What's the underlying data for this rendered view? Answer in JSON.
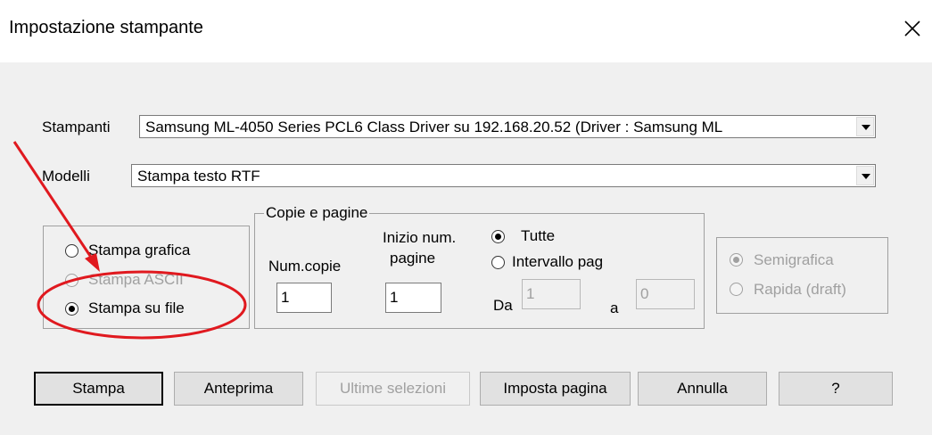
{
  "window": {
    "title": "Impostazione stampante"
  },
  "printers": {
    "label": "Stampanti",
    "selected": "Samsung ML-4050 Series PCL6 Class Driver su 192.168.20.52 (Driver : Samsung ML"
  },
  "models": {
    "label": "Modelli",
    "selected": "Stampa testo RTF"
  },
  "output_type": {
    "options": [
      {
        "label": "Stampa grafica",
        "checked": false,
        "enabled": true
      },
      {
        "label": "Stampa ASCII",
        "checked": false,
        "enabled": false
      },
      {
        "label": "Stampa su file",
        "checked": true,
        "enabled": true
      }
    ]
  },
  "copies_pages": {
    "legend": "Copie e pagine",
    "num_copies_label": "Num.copie",
    "num_copies_value": "1",
    "start_page_label_line1": "Inizio num.",
    "start_page_label_line2": "pagine",
    "start_page_value": "1",
    "all_label": "Tutte",
    "range_label": "Intervallo pag",
    "from_label": "Da",
    "from_value": "1",
    "to_label": "a",
    "to_value": "0"
  },
  "quality": {
    "options": [
      {
        "label": "Semigrafica",
        "checked": true,
        "enabled": false
      },
      {
        "label": "Rapida (draft)",
        "checked": false,
        "enabled": false
      }
    ]
  },
  "buttons": {
    "print": "Stampa",
    "preview": "Anteprima",
    "last_selections": "Ultime selezioni",
    "page_setup": "Imposta pagina",
    "cancel": "Annulla",
    "help": "?"
  },
  "annotation": {
    "color": "#e0191f"
  }
}
